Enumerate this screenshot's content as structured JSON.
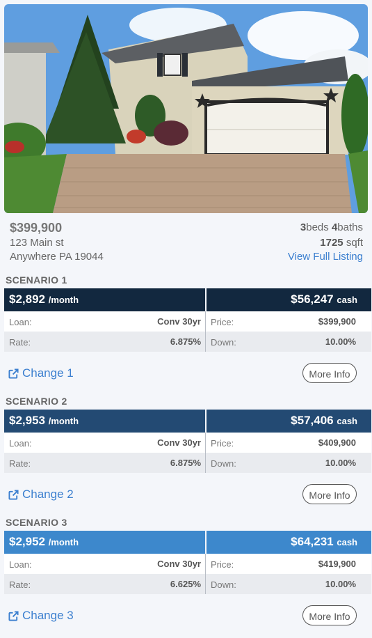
{
  "listing": {
    "price": "$399,900",
    "address_line1": "123 Main st",
    "address_line2": "Anywhere PA 19044",
    "beds": "3",
    "beds_label": "beds",
    "baths": "4",
    "baths_label": "baths",
    "sqft": "1725",
    "sqft_label": "sqft",
    "view_link": "View Full Listing"
  },
  "labels": {
    "loan": "Loan:",
    "rate": "Rate:",
    "price": "Price:",
    "down": "Down:",
    "per_month": "/month",
    "cash": "cash",
    "more_info": "More Info"
  },
  "scenarios": [
    {
      "title": "SCENARIO 1",
      "monthly": "$2,892",
      "cash": "$56,247",
      "loan": "Conv 30yr",
      "rate": "6.875%",
      "price": "$399,900",
      "down": "10.00%",
      "change_label": "Change 1",
      "bar_color": "#12283f"
    },
    {
      "title": "SCENARIO 2",
      "monthly": "$2,953",
      "cash": "$57,406",
      "loan": "Conv 30yr",
      "rate": "6.875%",
      "price": "$409,900",
      "down": "10.00%",
      "change_label": "Change 2",
      "bar_color": "#234a73"
    },
    {
      "title": "SCENARIO 3",
      "monthly": "$2,952",
      "cash": "$64,231",
      "loan": "Conv 30yr",
      "rate": "6.625%",
      "price": "$419,900",
      "down": "10.00%",
      "change_label": "Change 3",
      "bar_color": "#3d88cc"
    }
  ],
  "icons": {
    "external_link": "external-link-icon"
  }
}
